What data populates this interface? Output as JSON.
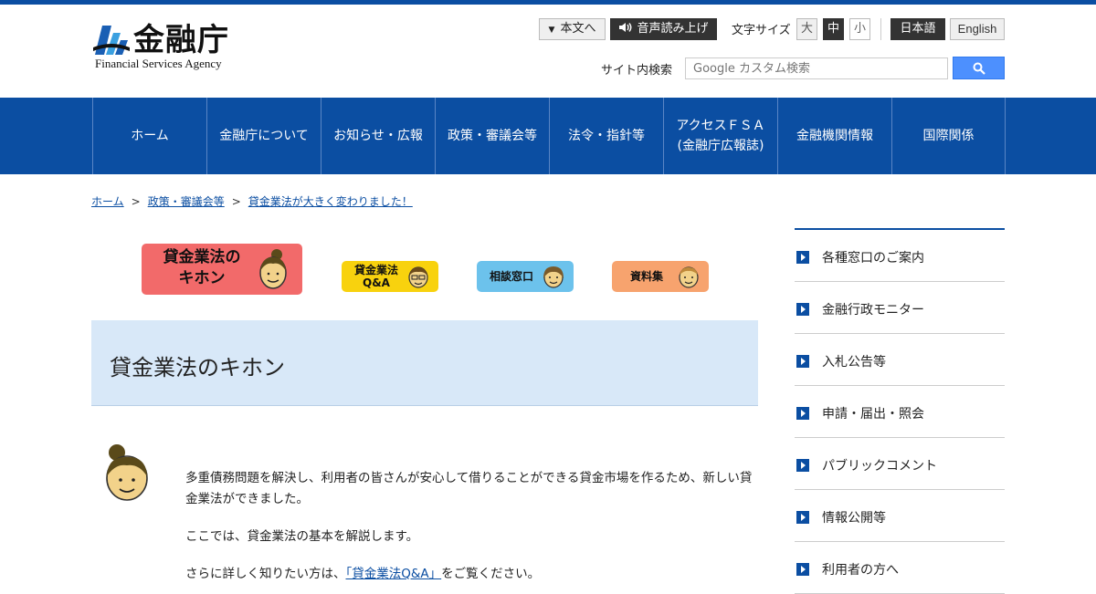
{
  "header": {
    "logo_ja": "金融庁",
    "logo_en": "Financial Services Agency",
    "skip_link": "本文へ",
    "voice_button": "音声読み上げ",
    "font_size_label": "文字サイズ",
    "font_sizes": [
      "大",
      "中",
      "小"
    ],
    "lang_ja": "日本語",
    "lang_en": "English",
    "search_label": "サイト内検索",
    "search_placeholder": "Google カスタム検索"
  },
  "gnav": [
    "ホーム",
    "金融庁について",
    "お知らせ・広報",
    "政策・審議会等",
    "法令・指針等",
    "アクセスＦＳＡ\n(金融庁広報誌)",
    "金融機関情報",
    "国際関係"
  ],
  "breadcrumb": {
    "home": "ホーム",
    "sep": ">",
    "policy": "政策・審議会等",
    "current": "貸金業法が大きく変わりました！"
  },
  "banners": {
    "main": "貸金業法の\nキホン",
    "qa_line1": "貸金業法",
    "qa_line2": "Q&A",
    "consult": "相談窓口",
    "docs": "資料集"
  },
  "page_title": "貸金業法のキホン",
  "body": {
    "para1": "多重債務問題を解決し、利用者の皆さんが安心して借りることができる貸金市場を作るため、新しい貸金業法ができました。",
    "para2": "ここでは、貸金業法の基本を解説します。",
    "para3_pre": "さらに詳しく知りたい方は、",
    "para3_link": "「貸金業法Q&A」",
    "para3_post": "をご覧ください。"
  },
  "side_nav": [
    "各種窓口のご案内",
    "金融行政モニター",
    "入札公告等",
    "申請・届出・照会",
    "パブリックコメント",
    "情報公開等",
    "利用者の方へ"
  ],
  "colors": {
    "brand_blue": "#0b4ea2",
    "title_bg": "#d8e8f8",
    "banner_red": "#f26a6a",
    "banner_yellow": "#f8d20e",
    "banner_blue": "#6cc2ec",
    "banner_orange": "#f7a36e"
  }
}
